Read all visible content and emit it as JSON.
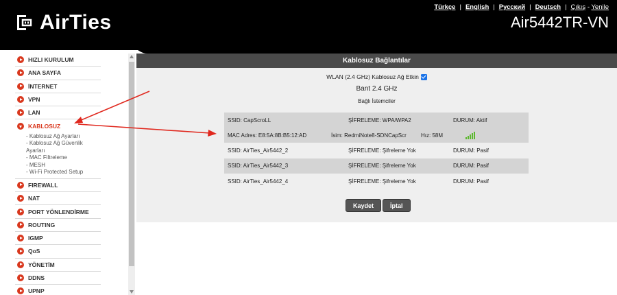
{
  "brand": {
    "logo_text": "AirTies",
    "model": "Air5442TR-VN"
  },
  "langbar": {
    "links": [
      "Türkçe",
      "English",
      "Русский",
      "Deutsch"
    ],
    "logout": "Çıkış",
    "separator": "-",
    "refresh": "Yenile"
  },
  "sidebar": {
    "items": [
      {
        "label": "HIZLI KURULUM"
      },
      {
        "label": "ANA SAYFA"
      },
      {
        "label": "İNTERNET"
      },
      {
        "label": "VPN"
      },
      {
        "label": "LAN"
      },
      {
        "label": "KABLOSUZ"
      },
      {
        "label": "FIREWALL"
      },
      {
        "label": "NAT"
      },
      {
        "label": "PORT YÖNLENDİRME"
      },
      {
        "label": "ROUTING"
      },
      {
        "label": "IGMP"
      },
      {
        "label": "QoS"
      },
      {
        "label": "YÖNETİM"
      },
      {
        "label": "DDNS"
      },
      {
        "label": "UPNP"
      }
    ],
    "sub_items": [
      "- Kablosuz Ağ Ayarları",
      "- Kablosuz Ağ Güvenlik Ayarları",
      "- MAC Filtreleme",
      "- MESH",
      "- Wi-Fi Protected Setup"
    ]
  },
  "main": {
    "title": "Kablosuz Bağlantılar",
    "wlan_label": "WLAN (2.4 GHz) Kablosuz Ağ Etkin",
    "wlan_enabled": true,
    "band": "Bant 2.4 GHz",
    "clients_title": "Bağlı İstemciler",
    "networks": [
      {
        "ssid": "SSID: CapScroLL",
        "security": "ŞİFRELEME: WPA/WPA2",
        "status": "DURUM: Aktif"
      },
      {
        "ssid": "SSID: AirTies_Air5442_2",
        "security": "ŞİFRELEME: Şifreleme Yok",
        "status": "DURUM: Pasif"
      },
      {
        "ssid": "SSID: AirTies_Air5442_3",
        "security": "ŞİFRELEME: Şifreleme Yok",
        "status": "DURUM: Pasif"
      },
      {
        "ssid": "SSID: AirTies_Air5442_4",
        "security": "ŞİFRELEME: Şifreleme Yok",
        "status": "DURUM: Pasif"
      }
    ],
    "client": {
      "mac": "MAC Adres: E8:5A:8B:B5:12:AD",
      "name": "İsim: RedmiNote8-SDNCapScr",
      "speed": "Hız: 58M",
      "signal_level": 5
    },
    "save_label": "Kaydet",
    "cancel_label": "İptal"
  },
  "colors": {
    "header_bg": "#000000",
    "accent": "#d9381e",
    "signal": "#5cb82e",
    "annotation_arrow": "#e0281e"
  }
}
